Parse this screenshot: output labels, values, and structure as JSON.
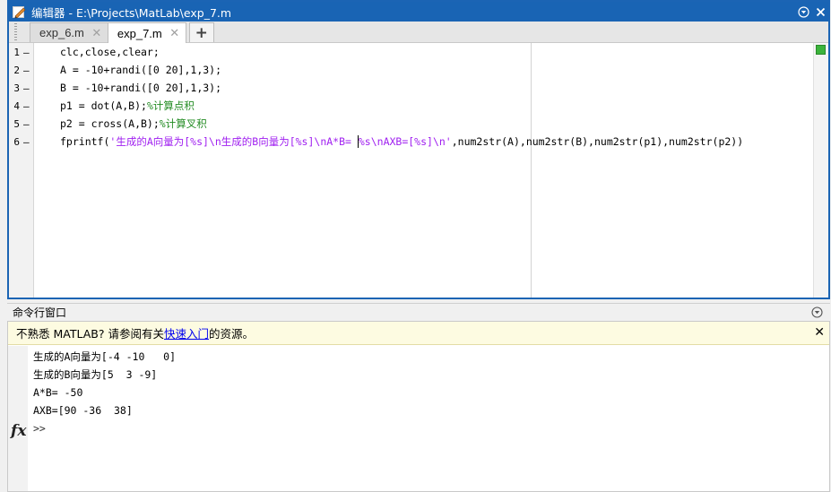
{
  "editor": {
    "title": "编辑器 - E:\\Projects\\MatLab\\exp_7.m",
    "tabs": [
      {
        "label": "exp_6.m",
        "close": "✕",
        "active": false
      },
      {
        "label": "exp_7.m",
        "close": "✕",
        "active": true
      }
    ],
    "add_tab": "+",
    "lines": [
      {
        "num": "1",
        "mark": "–",
        "code": "clc,close,clear;"
      },
      {
        "num": "2",
        "mark": "–",
        "code": "A = -10+randi([0 20],1,3);"
      },
      {
        "num": "3",
        "mark": "–",
        "code": "B = -10+randi([0 20],1,3);"
      },
      {
        "num": "4",
        "mark": "–",
        "code_pre": "p1 = dot(A,B);",
        "comment": "%计算点积"
      },
      {
        "num": "5",
        "mark": "–",
        "code_pre": "p2 = cross(A,B);",
        "comment": "%计算叉积"
      },
      {
        "num": "6",
        "mark": "–",
        "code_pre": "fprintf(",
        "string_a": "'生成的A向量为[%s]\\n生成的B向量为[%s]\\nA*B= ",
        "string_b": "%s\\nAXB=[%s]\\n'",
        "code_post": ",num2str(A),num2str(B),num2str(p1),num2str(p2))"
      }
    ],
    "status_color": "#3cb43c"
  },
  "command_window": {
    "title": "命令行窗口",
    "notice": {
      "text_before": "不熟悉 MATLAB? 请参阅有关",
      "link": "快速入门",
      "text_after": "的资源。",
      "close": "✕"
    },
    "output": [
      "生成的A向量为[-4 -10   0]",
      "生成的B向量为[5  3 -9]",
      "A*B= -50",
      "AXB=[90 -36  38]"
    ],
    "prompt": ">>",
    "fx": "fx"
  },
  "colors": {
    "titlebar": "#1964b4",
    "string": "#a020f0",
    "comment": "#228b22",
    "notice_bg": "#fdfbe1"
  }
}
